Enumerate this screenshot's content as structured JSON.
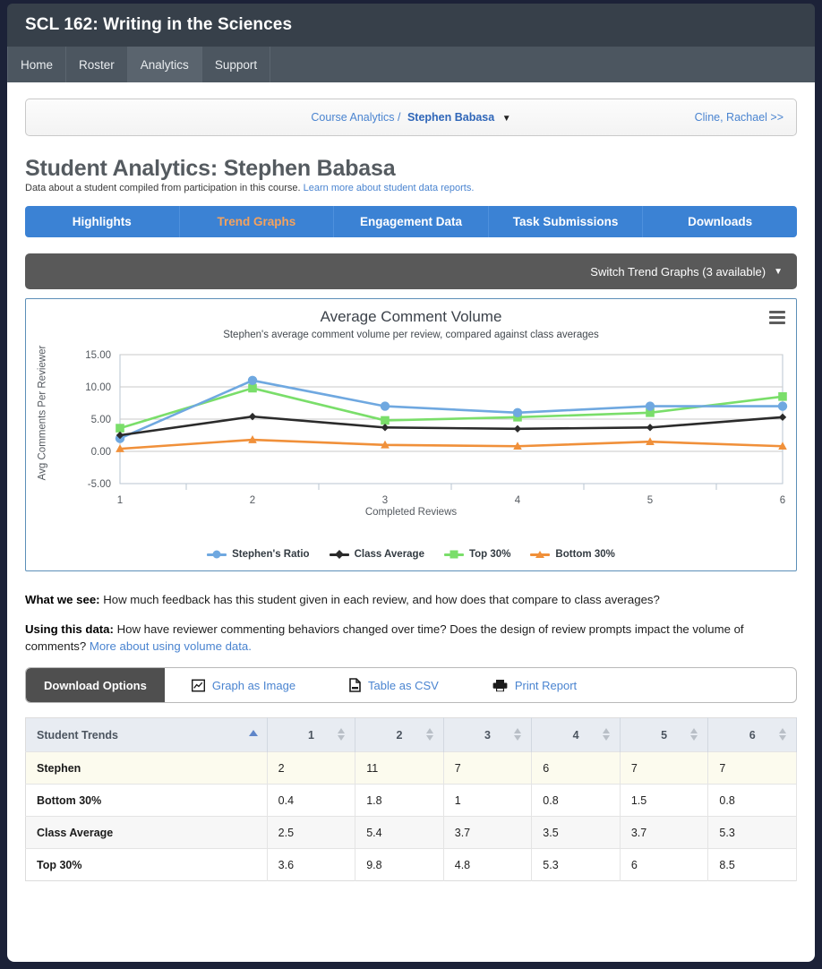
{
  "header": {
    "course_title": "SCL 162: Writing in the Sciences",
    "nav": [
      {
        "label": "Home",
        "active": false
      },
      {
        "label": "Roster",
        "active": false
      },
      {
        "label": "Analytics",
        "active": true
      },
      {
        "label": "Support",
        "active": false
      }
    ]
  },
  "breadcrumb": {
    "parent": "Course Analytics /",
    "current": "Stephen Babasa",
    "caret": "▼",
    "next_student": "Cline, Rachael >>"
  },
  "page": {
    "title": "Student Analytics: Stephen Babasa",
    "subtitle": "Data about a student compiled from participation in this course.",
    "subtitle_link": "Learn more about student data reports."
  },
  "tabs": [
    {
      "label": "Highlights",
      "active": false
    },
    {
      "label": "Trend Graphs",
      "active": true
    },
    {
      "label": "Engagement Data",
      "active": false
    },
    {
      "label": "Task Submissions",
      "active": false
    },
    {
      "label": "Downloads",
      "active": false
    }
  ],
  "switch_bar": {
    "label": "Switch Trend Graphs (3 available)",
    "caret": "▼"
  },
  "chart_data": {
    "type": "line",
    "title": "Average Comment Volume",
    "subtitle": "Stephen's average comment volume per review, compared against class averages",
    "xlabel": "Completed Reviews",
    "ylabel": "Avg Comments Per Reviewer",
    "categories": [
      "1",
      "2",
      "3",
      "4",
      "5",
      "6"
    ],
    "x": [
      1,
      2,
      3,
      4,
      5,
      6
    ],
    "ylim": [
      -5,
      15
    ],
    "yticks": [
      "-5.00",
      "0.00",
      "5.00",
      "10.00",
      "15.00"
    ],
    "ytick_values": [
      -5,
      0,
      5,
      10,
      15
    ],
    "grid": true,
    "legend_position": "bottom",
    "series": [
      {
        "name": "Stephen's Ratio",
        "values": [
          2,
          11,
          7,
          6,
          7,
          7
        ],
        "color": "#6fa8e0",
        "marker": "circle"
      },
      {
        "name": "Class Average",
        "values": [
          2.5,
          5.4,
          3.7,
          3.5,
          3.7,
          5.3
        ],
        "color": "#2b2b2b",
        "marker": "diamond"
      },
      {
        "name": "Top 30%",
        "values": [
          3.6,
          9.8,
          4.8,
          5.3,
          6,
          8.5
        ],
        "color": "#7ade6a",
        "marker": "square"
      },
      {
        "name": "Bottom 30%",
        "values": [
          0.4,
          1.8,
          1,
          0.8,
          1.5,
          0.8
        ],
        "color": "#f0903a",
        "marker": "triangle"
      }
    ]
  },
  "narrative": {
    "what_we_see_label": "What we see:",
    "what_we_see_text": " How much feedback has this student given in each review, and how does that compare to class averages?",
    "using_label": "Using this data:",
    "using_text": " How have reviewer commenting behaviors changed over time? Does the design of review prompts impact the volume of comments? ",
    "using_link": "More about using volume data."
  },
  "download_bar": {
    "heading": "Download Options",
    "options": [
      {
        "label": "Graph as Image",
        "icon": "chart-image-icon"
      },
      {
        "label": "Table as CSV",
        "icon": "csv-file-icon"
      },
      {
        "label": "Print Report",
        "icon": "printer-icon"
      }
    ]
  },
  "table": {
    "columns": [
      "Student Trends",
      "1",
      "2",
      "3",
      "4",
      "5",
      "6"
    ],
    "rows": [
      {
        "label": "Stephen",
        "values": [
          "2",
          "11",
          "7",
          "6",
          "7",
          "7"
        ],
        "highlight": true
      },
      {
        "label": "Bottom 30%",
        "values": [
          "0.4",
          "1.8",
          "1",
          "0.8",
          "1.5",
          "0.8"
        ],
        "highlight": false
      },
      {
        "label": "Class Average",
        "values": [
          "2.5",
          "5.4",
          "3.7",
          "3.5",
          "3.7",
          "5.3"
        ],
        "highlight": false
      },
      {
        "label": "Top 30%",
        "values": [
          "3.6",
          "9.8",
          "4.8",
          "5.3",
          "6",
          "8.5"
        ],
        "highlight": false
      }
    ]
  },
  "colors": {
    "accent_blue": "#3b82d4",
    "active_tab_text": "#f5a25d",
    "dark_bar": "#595959",
    "link": "#4a84d0"
  }
}
